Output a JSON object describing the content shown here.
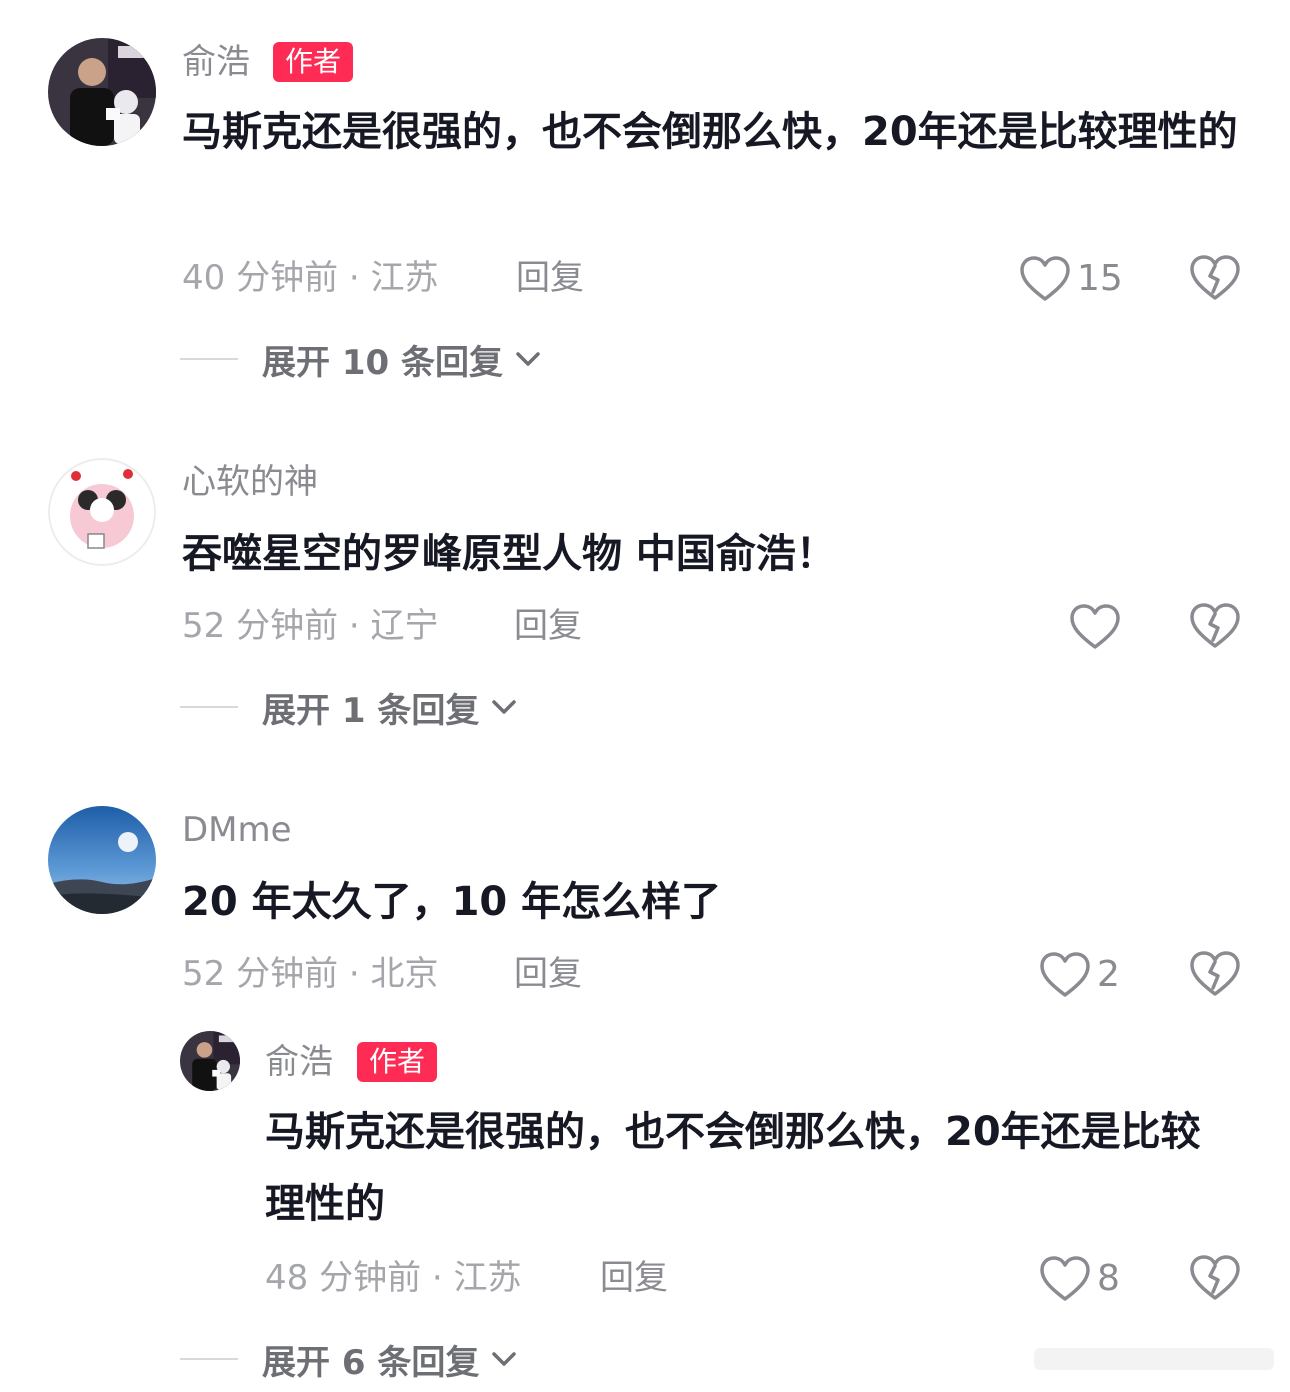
{
  "comments": [
    {
      "username": "俞浩",
      "badge": "作者",
      "text": "马斯克还是很强的，也不会倒那么快，20年还是比较理性的",
      "meta": "40 分钟前 · 江苏",
      "reply_label": "回复",
      "likes": "15",
      "expand_label": "展开 10 条回复"
    },
    {
      "username": "心软的神",
      "text": "吞噬星空的罗峰原型人物 中国俞浩！",
      "meta": "52 分钟前 · 辽宁",
      "reply_label": "回复",
      "likes": "",
      "expand_label": "展开 1 条回复"
    },
    {
      "username": "DMme",
      "text": "20 年太久了，10 年怎么样了",
      "meta": "52 分钟前 · 北京",
      "reply_label": "回复",
      "likes": "2",
      "replies": [
        {
          "username": "俞浩",
          "badge": "作者",
          "text": "马斯克还是很强的，也不会倒那么快，20年还是比较理性的",
          "meta": "48 分钟前 · 江苏",
          "reply_label": "回复",
          "likes": "8"
        }
      ],
      "expand_label": "展开 6 条回复"
    }
  ],
  "icons": {
    "like": "heart-outline-icon",
    "dislike": "broken-heart-icon",
    "expand": "chevron-down-icon"
  },
  "colors": {
    "badge": "#fe2c55",
    "username": "#8a8b91",
    "text": "#161823",
    "meta": "#a5a6ab"
  }
}
